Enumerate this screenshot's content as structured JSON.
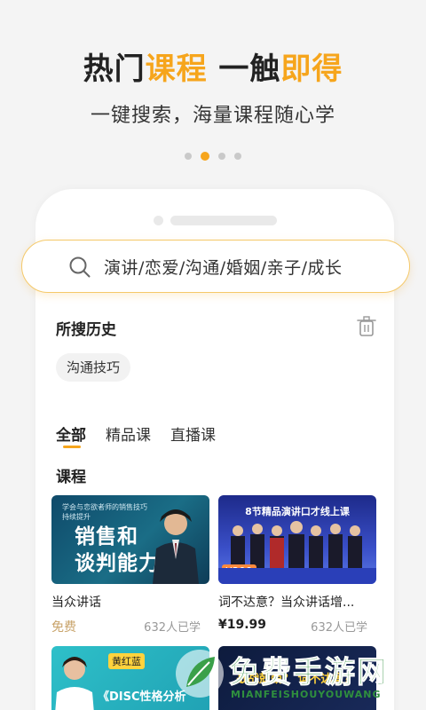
{
  "hero": {
    "title_part1": "热门",
    "title_highlight1": "课程",
    "title_part2": " 一触",
    "title_highlight2": "即得",
    "subtitle": "一键搜索，海量课程随心学"
  },
  "pager": {
    "total": 4,
    "active_index": 1
  },
  "search": {
    "placeholder": "演讲/恋爱/沟通/婚姻/亲子/成长",
    "icon": "search-icon"
  },
  "history": {
    "title": "所搜历史",
    "clear_icon": "trash-icon",
    "chips": [
      "沟通技巧"
    ]
  },
  "tabs": [
    {
      "label": "全部",
      "active": true
    },
    {
      "label": "精品课",
      "active": false
    },
    {
      "label": "直播课",
      "active": false
    }
  ],
  "courses_section": {
    "title": "课程",
    "cards": [
      {
        "title": "当众讲话",
        "price": "免费",
        "learners": "632人已学",
        "thumb_small": "学会与恋欲者师的销售技巧 持续提升",
        "thumb_big": "销售和\n谈判能力"
      },
      {
        "title": "词不达意？当众讲话增...",
        "price": "¥19.99",
        "learners": "632人已学",
        "thumb_header": "8节精品演讲口才线上课",
        "thumb_badge": "¥399"
      },
      {
        "thumb_tag": "黄红蓝",
        "thumb_text": "《DISC性格分析"
      },
      {
        "thumb_text": "战战兢兢？ 词不达意？"
      }
    ]
  },
  "watermark": {
    "main": "免费手游网",
    "sub": "MIANFEISHOUYOUWANG"
  },
  "colors": {
    "accent": "#f6a51c",
    "free_price": "#c8a36a"
  }
}
